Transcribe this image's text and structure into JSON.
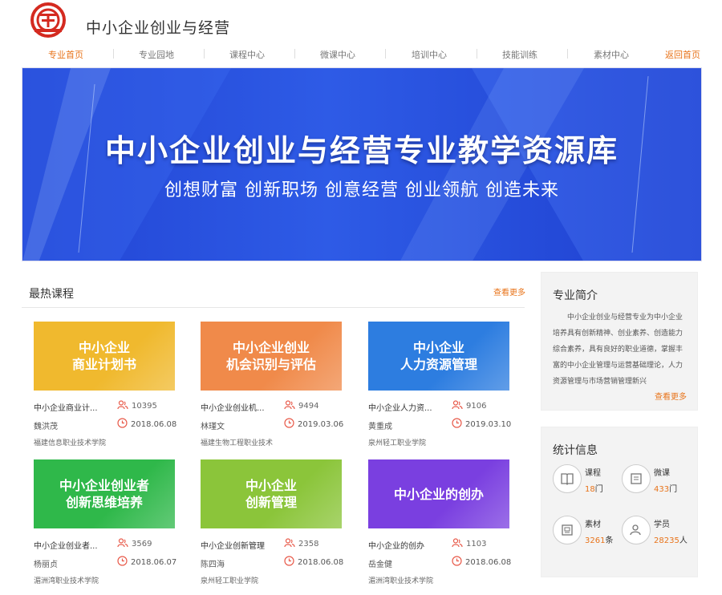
{
  "header": {
    "site_title": "中小企业创业与经营"
  },
  "nav": {
    "items": [
      "专业首页",
      "专业园地",
      "课程中心",
      "微课中心",
      "培训中心",
      "技能训练",
      "素材中心"
    ],
    "home_link": "返回首页"
  },
  "banner": {
    "title": "中小企业创业与经营专业教学资源库",
    "subtitle": "创想财富 创新职场 创意经营 创业领航 创造未来"
  },
  "hot_courses": {
    "title": "最热课程",
    "more": "查看更多",
    "courses": [
      {
        "thumb": "中小企业\n商业计划书",
        "name": "中小企业商业计...",
        "views": "10395",
        "teacher": "魏洪茂",
        "date": "2018.06.08",
        "school": "福建信息职业技术学院",
        "color": "#f0b92e"
      },
      {
        "thumb": "中小企业创业\n机会识别与评估",
        "name": "中小企业创业机...",
        "views": "9494",
        "teacher": "林瑾文",
        "date": "2019.03.06",
        "school": "福建生物工程职业技术",
        "color": "#f08a4a"
      },
      {
        "thumb": "中小企业\n人力资源管理",
        "name": "中小企业人力资...",
        "views": "9106",
        "teacher": "黄重成",
        "date": "2019.03.10",
        "school": "泉州轻工职业学院",
        "color": "#2d7de0"
      },
      {
        "thumb": "中小企业创业者\n创新思维培养",
        "name": "中小企业创业者...",
        "views": "3569",
        "teacher": "杨丽贞",
        "date": "2018.06.07",
        "school": "湄洲湾职业技术学院",
        "color": "#2fb84a"
      },
      {
        "thumb": "中小企业\n创新管理",
        "name": "中小企业创新管理",
        "views": "2358",
        "teacher": "陈四海",
        "date": "2018.06.08",
        "school": "泉州轻工职业学院",
        "color": "#8bc53a"
      },
      {
        "thumb": "中小企业的创办",
        "name": "中小企业的创办",
        "views": "1103",
        "teacher": "岳金健",
        "date": "2018.06.08",
        "school": "湄洲湾职业技术学院",
        "color": "#7a3fe0"
      }
    ]
  },
  "intro": {
    "title": "专业简介",
    "text": "中小企业创业与经营专业为中小企业培养具有创新精神、创业素养、创造能力综合素养，具有良好的职业道德，掌握丰富的中小企业管理与运营基础理论，人力资源管理与市场营销管理新兴",
    "more": "查看更多"
  },
  "stats": {
    "title": "统计信息",
    "items": [
      {
        "label": "课程",
        "value": "18",
        "unit": "门",
        "icon": "book-icon"
      },
      {
        "label": "微课",
        "value": "433",
        "unit": "门",
        "icon": "screen-icon"
      },
      {
        "label": "素材",
        "value": "3261",
        "unit": "条",
        "icon": "picture-icon"
      },
      {
        "label": "学员",
        "value": "28235",
        "unit": "人",
        "icon": "user-icon"
      }
    ]
  },
  "colors": {
    "accent": "#e8741b",
    "logo_red": "#d42a20",
    "banner_blue": "#2e5be6"
  }
}
